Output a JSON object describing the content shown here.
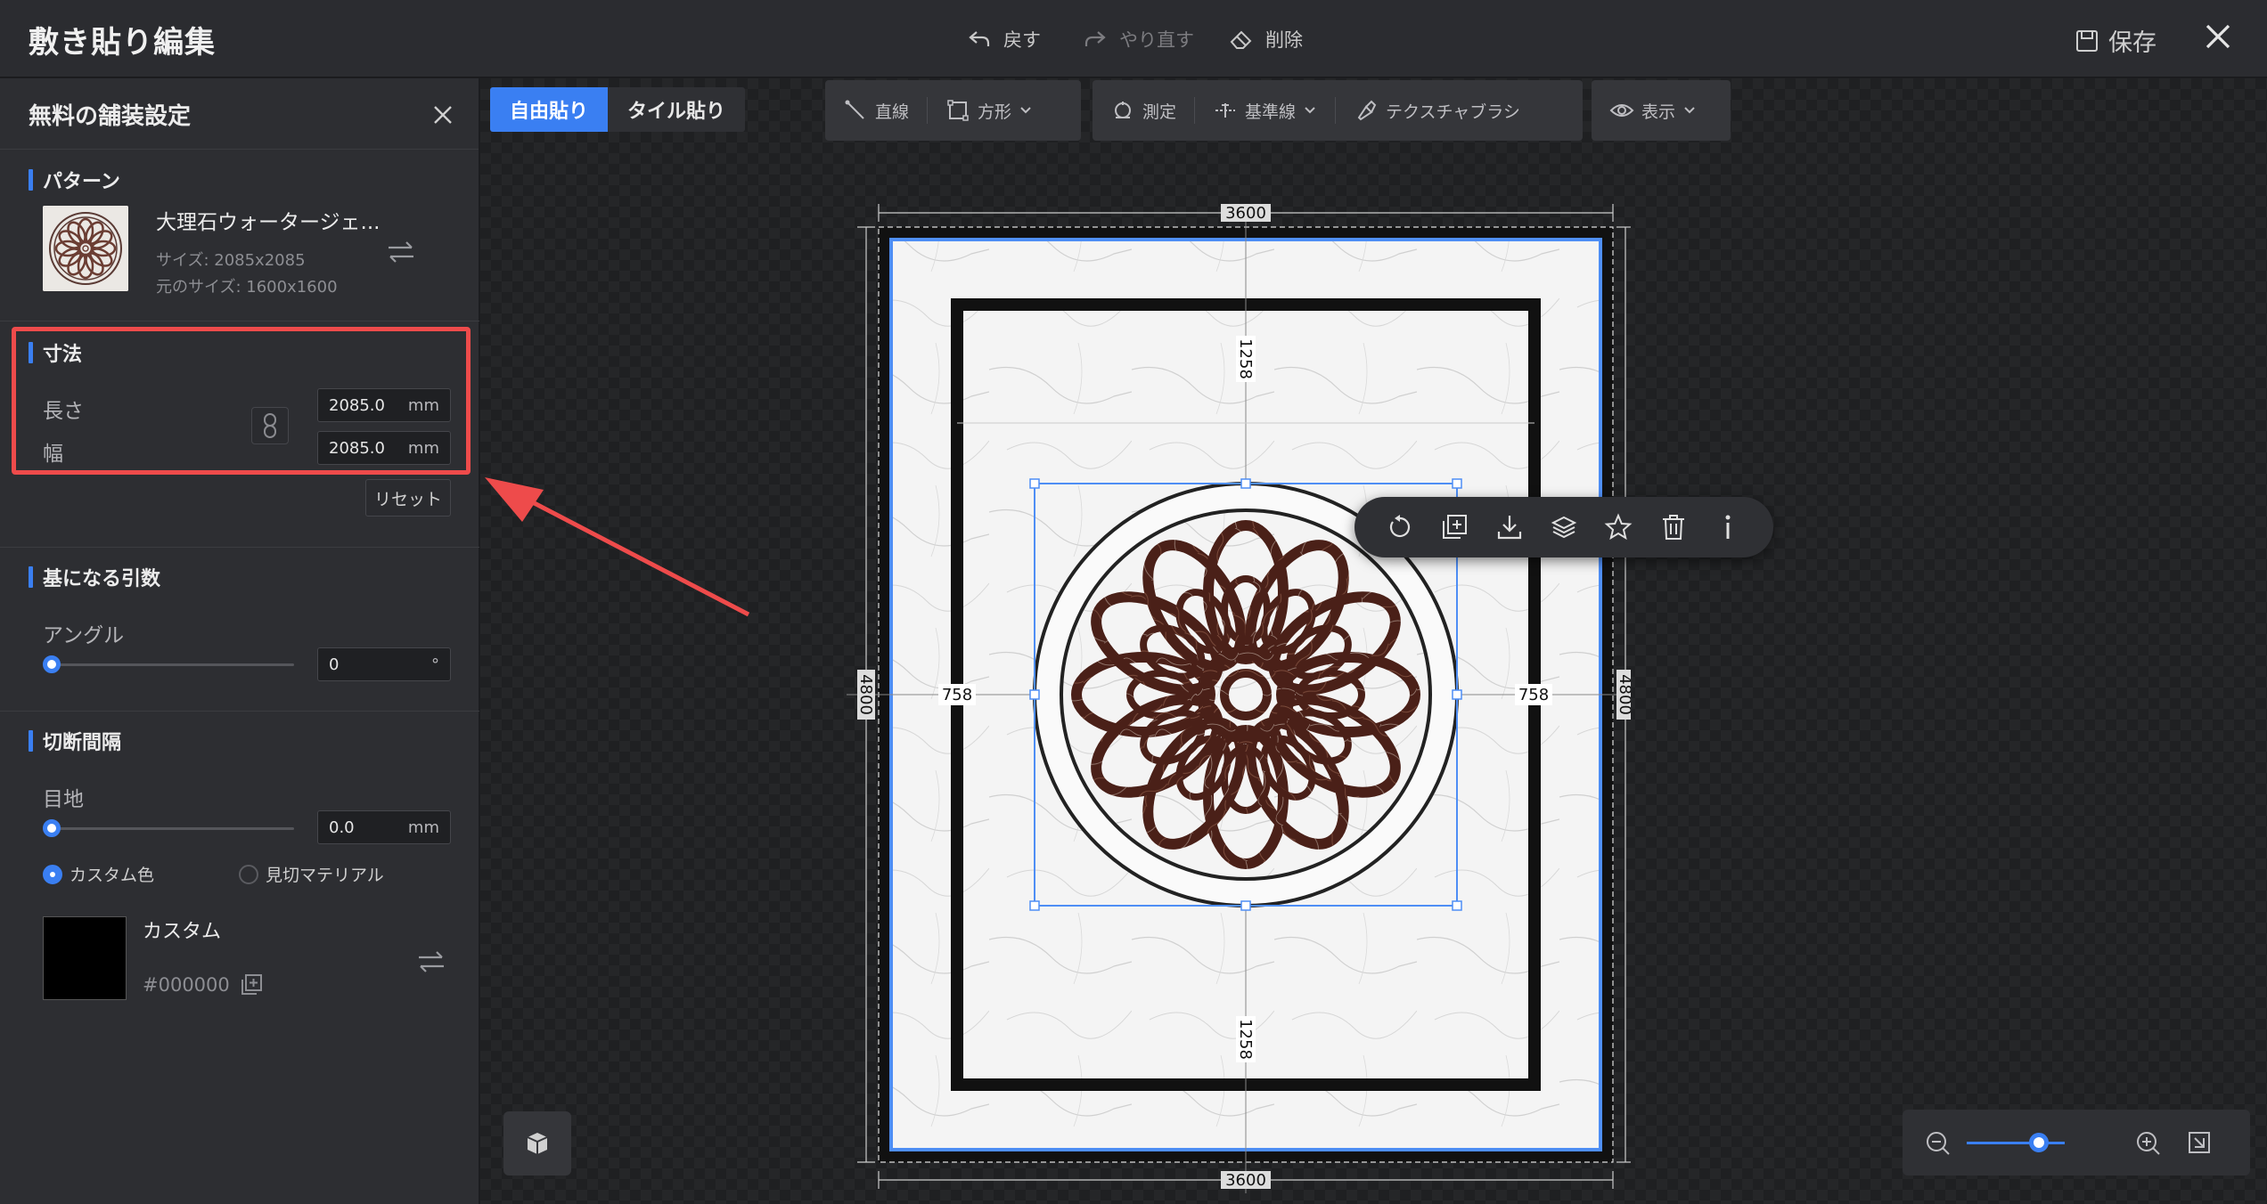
{
  "window": {
    "title": "敷き貼り編集",
    "undo_label": "戻す",
    "redo_label": "やり直す",
    "delete_label": "削除",
    "save_label": "保存"
  },
  "sidebar": {
    "title": "無料の舗装設定",
    "pattern": {
      "section_title": "パターン",
      "name": "大理石ウォータージェ...",
      "size_text": "サイズ: 2085x2085",
      "original_size_text": "元のサイズ: 1600x1600"
    },
    "dimensions": {
      "section_title": "寸法",
      "length_label": "長さ",
      "length_value": "2085.0",
      "length_unit": "mm",
      "width_label": "幅",
      "width_value": "2085.0",
      "width_unit": "mm",
      "reset_label": "リセット"
    },
    "base_params": {
      "section_title": "基になる引数",
      "angle_label": "アングル",
      "angle_value": "0",
      "angle_unit": "°",
      "angle_slider_fraction": 0
    },
    "cut_spacing": {
      "section_title": "切断間隔",
      "joint_label": "目地",
      "joint_value": "0.0",
      "joint_unit": "mm",
      "joint_slider_fraction": 0,
      "radio_custom_label": "カスタム色",
      "radio_material_label": "見切マテリアル",
      "selected": "custom",
      "color_name": "カスタム",
      "color_hex": "#000000"
    }
  },
  "canvas": {
    "mode_tabs": [
      {
        "label": "自由貼り",
        "active": true
      },
      {
        "label": "タイル貼り",
        "active": false
      }
    ],
    "tools": {
      "line_label": "直線",
      "rect_label": "方形",
      "measure_label": "測定",
      "baseline_label": "基準線",
      "texture_brush_label": "テクスチャブラシ",
      "view_label": "表示"
    },
    "dimensions": {
      "top": "3600",
      "bottom": "3600",
      "left": "4800",
      "right": "4800",
      "inner_top": "1258",
      "inner_bottom": "1258",
      "inner_left": "758",
      "inner_right": "758"
    },
    "zoom_fraction": 0.8
  },
  "colors": {
    "accent": "#3a7ff2",
    "highlight": "#ee4b4b",
    "panel": "#2d2e32",
    "topbar": "#2b2c30"
  },
  "icons": {
    "undo": "undo-icon",
    "redo": "redo-icon",
    "delete": "eraser-icon",
    "save": "save-icon",
    "close": "close-icon"
  }
}
